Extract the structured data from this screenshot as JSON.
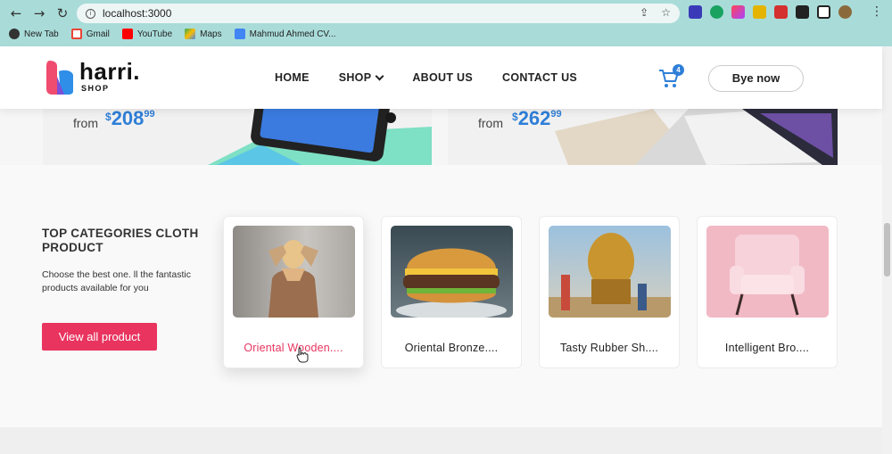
{
  "browser": {
    "url": "localhost:3000",
    "bookmarks": [
      {
        "label": "New Tab",
        "icon": "globe-icon",
        "color": "#333333"
      },
      {
        "label": "Gmail",
        "icon": "gmail-icon",
        "color": "#ea4335"
      },
      {
        "label": "YouTube",
        "icon": "youtube-icon",
        "color": "#ff0000"
      },
      {
        "label": "Maps",
        "icon": "maps-icon",
        "color": "#34a853"
      },
      {
        "label": "Mahmud Ahmed CV...",
        "icon": "docs-icon",
        "color": "#4285f4"
      }
    ]
  },
  "header": {
    "logo_name": "harri.",
    "logo_sub": "SHOP",
    "nav": [
      "HOME",
      "SHOP",
      "ABOUT US",
      "CONTACT US"
    ],
    "cart_count": "4",
    "cta": "Bye now"
  },
  "banners": [
    {
      "from": "from",
      "currency": "$",
      "amount": "208",
      "cents": "99"
    },
    {
      "from": "from",
      "currency": "$",
      "amount": "262",
      "cents": "99"
    }
  ],
  "categories": {
    "title": "TOP CATEGORIES CLOTH PRODUCT",
    "description": "Choose the best one. ll the fantastic products available for you",
    "button": "View all product",
    "items": [
      {
        "name": "Oriental Wooden....",
        "image": "woman-sweater"
      },
      {
        "name": "Oriental Bronze....",
        "image": "burger"
      },
      {
        "name": "Tasty Rubber Sh....",
        "image": "golden-statue"
      },
      {
        "name": "Intelligent Bro....",
        "image": "pink-chair"
      }
    ]
  },
  "colors": {
    "accent": "#e8345f",
    "price_blue": "#2f7fd8",
    "chrome": "#a9dcd9"
  }
}
